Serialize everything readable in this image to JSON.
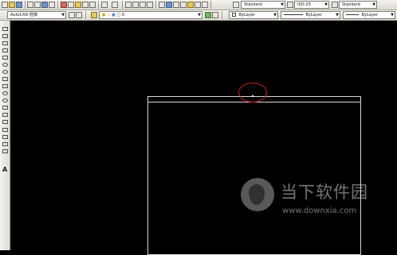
{
  "toolbar": {
    "text_style": "Standard",
    "dim_style": "ISO-25",
    "table_style": "Standard"
  },
  "workspace": {
    "selected": "AutoCAD 经典"
  },
  "layer": {
    "current": "0"
  },
  "properties": {
    "color": "ByLayer",
    "linetype": "ByLayer",
    "lineweight": "ByLayer"
  },
  "draw_toolbar": {
    "text_tool_glyph": "A"
  },
  "watermark": {
    "brand": "当下软件园",
    "url": "www.downxia.com"
  }
}
